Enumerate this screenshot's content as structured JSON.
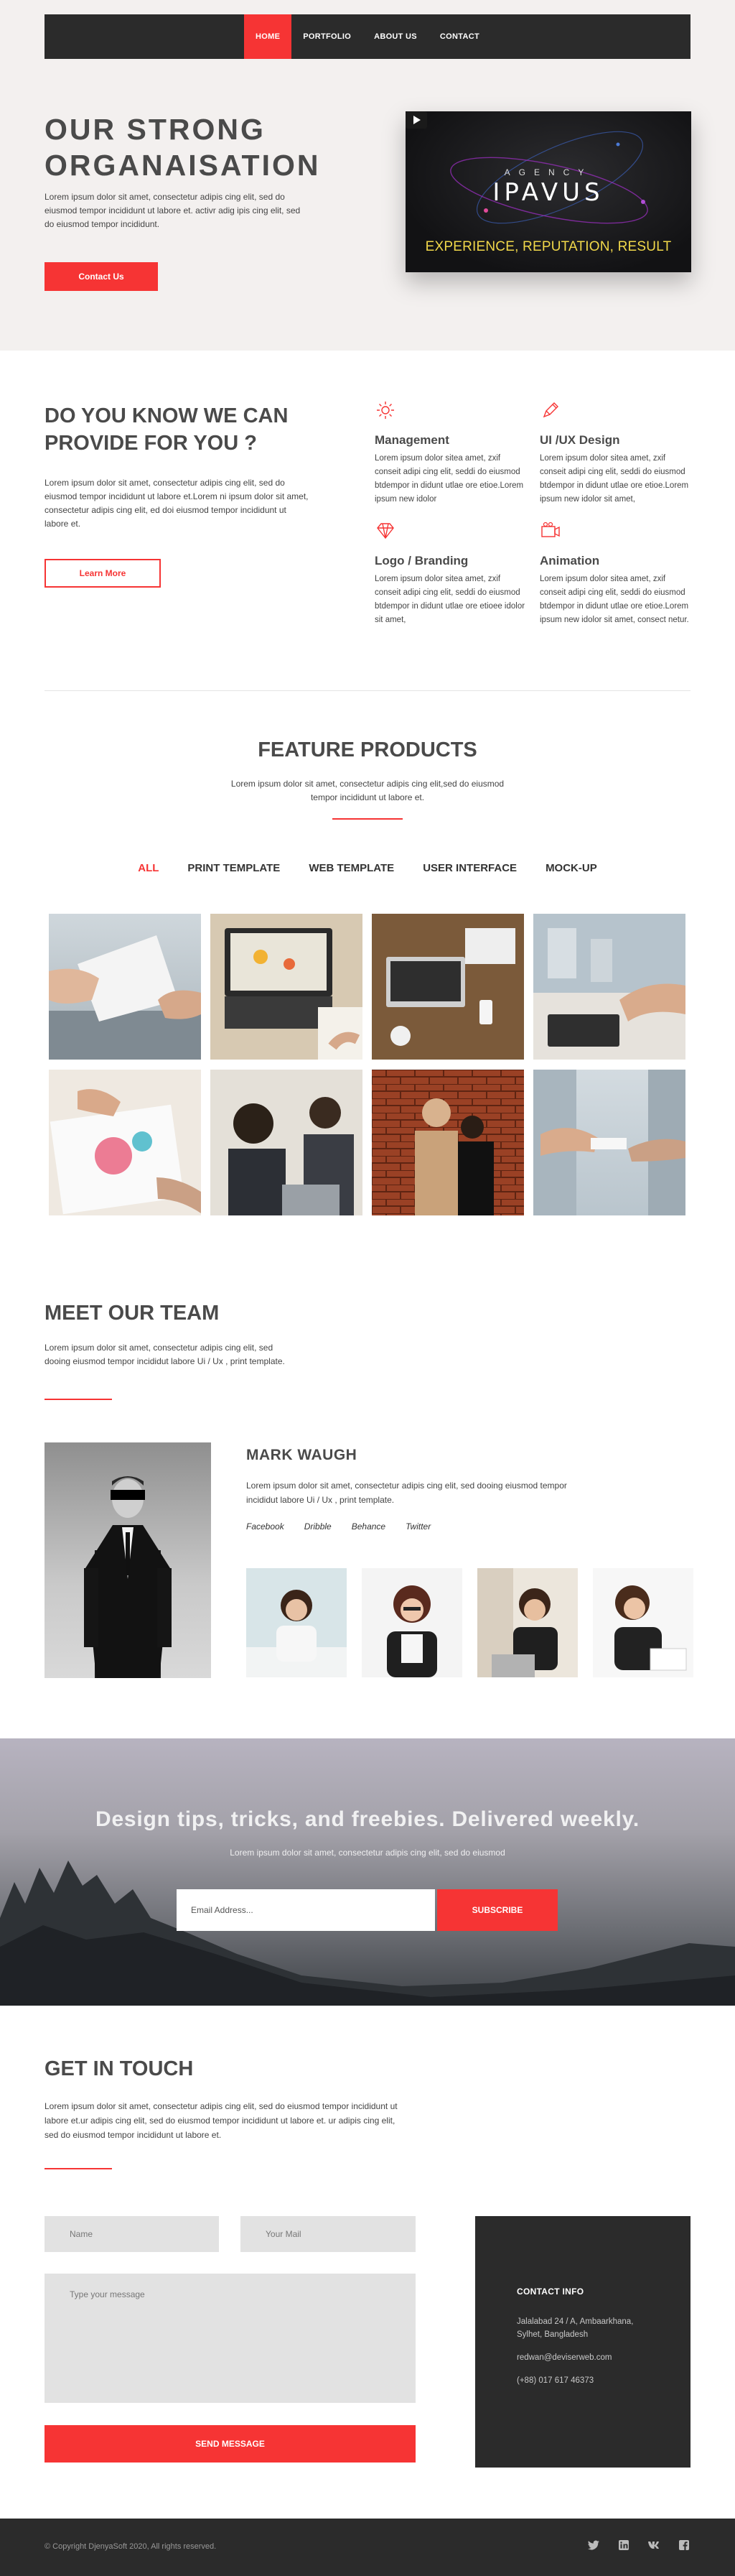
{
  "nav": {
    "items": [
      "HOME",
      "PORTFOLIO",
      "ABOUT US",
      "CONTACT"
    ],
    "active": "HOME"
  },
  "hero": {
    "title_line1": "OUR STRONG",
    "title_line2": "ORGANAISATION",
    "text": "Lorem ipsum dolor sit amet, consectetur adipis cing elit, sed do eiusmod tempor incididunt ut labore et. activr adig ipis cing elit, sed do eiusmod tempor incididunt.",
    "button": "Contact Us",
    "video": {
      "agency": "AGENCY",
      "brand": "IPAVUS",
      "tagline": "EXPERIENCE, REPUTATION, RESULT"
    }
  },
  "services": {
    "title": "DO YOU KNOW WE CAN PROVIDE FOR YOU ?",
    "text": "Lorem ipsum dolor sit amet, consectetur adipis cing elit, sed do eiusmod tempor incididunt ut labore et.Lorem ni ipsum dolor sit amet, consectetur adipis cing elit, ed doi eiusmod tempor incididunt ut labore et.",
    "button": "Learn More",
    "features": [
      {
        "icon": "gear-icon",
        "title": "Management",
        "text": "Lorem ipsum dolor sitea amet, zxif conseit adipi cing elit, seddi do eiusmod btdempor in didunt utlae ore etioe.Lorem ipsum new idolor"
      },
      {
        "icon": "pencil-icon",
        "title": "UI /UX Design",
        "text": "Lorem ipsum dolor sitea amet, zxif conseit adipi cing elit, seddi do eiusmod btdempor in didunt utlae ore etioe.Lorem ipsum new idolor sit amet,"
      },
      {
        "icon": "diamond-icon",
        "title": "Logo / Branding",
        "text": "Lorem ipsum dolor sitea amet, zxif conseit adipi cing elit, seddi do eiusmod btdempor in didunt utlae ore etioee idolor sit amet,"
      },
      {
        "icon": "video-camera-icon",
        "title": "Animation",
        "text": "Lorem ipsum dolor sitea amet, zxif conseit adipi cing elit, seddi do eiusmod btdempor in didunt utlae ore etioe.Lorem ipsum new idolor sit amet, consect netur."
      }
    ]
  },
  "products": {
    "title": "FEATURE PRODUCTS",
    "subtitle": "Lorem ipsum dolor sit amet, consectetur adipis cing elit,sed do eiusmod tempor incididunt ut labore et.",
    "filters": [
      "ALL",
      "PRINT TEMPLATE",
      "WEB TEMPLATE",
      "USER INTERFACE",
      "MOCK-UP"
    ],
    "active_filter": "ALL"
  },
  "team": {
    "title": "MEET OUR TEAM",
    "subtitle": "Lorem ipsum dolor sit amet, consectetur adipis cing elit, sed dooing eiusmod tempor incididut labore Ui / Ux , print template.",
    "member": {
      "name": "MARK WAUGH",
      "bio": "Lorem ipsum dolor sit amet, consectetur adipis cing elit, sed dooing eiusmod tempor incididut labore Ui / Ux , print template.",
      "social": [
        "Facebook",
        "Dribble",
        "Behance",
        "Twitter"
      ]
    }
  },
  "newsletter": {
    "title": "Design tips, tricks, and freebies. Delivered weekly.",
    "subtitle": "Lorem ipsum dolor sit amet, consectetur adipis cing elit, sed do eiusmod",
    "placeholder": "Email Address...",
    "button": "SUBSCRIBE"
  },
  "contact": {
    "title": "GET IN TOUCH",
    "text": "Lorem ipsum dolor sit amet, consectetur adipis cing elit, sed do eiusmod tempor incididunt ut labore et.ur adipis cing elit, sed do eiusmod tempor incididunt ut labore et. ur adipis cing elit, sed do eiusmod tempor incididunt ut labore et.",
    "name_placeholder": "Name",
    "mail_placeholder": "Your Mail",
    "message_placeholder": "Type your message",
    "button": "SEND MESSAGE",
    "info": {
      "title": "CONTACT INFO",
      "address": "Jalalabad 24 / A, Ambaarkhana, Sylhet, Bangladesh",
      "email": "redwan@deviserweb.com",
      "phone": "(+88) 017 617 46373"
    }
  },
  "footer": {
    "copyright": "© Copyright DjenyaSoft 2020, All rights reserved.",
    "icons": [
      "twitter-icon",
      "linkedin-icon",
      "vk-icon",
      "facebook-icon"
    ]
  },
  "colors": {
    "accent": "#f63434",
    "dark": "#2b2b2b",
    "hero_bg": "#f3f0ef"
  }
}
